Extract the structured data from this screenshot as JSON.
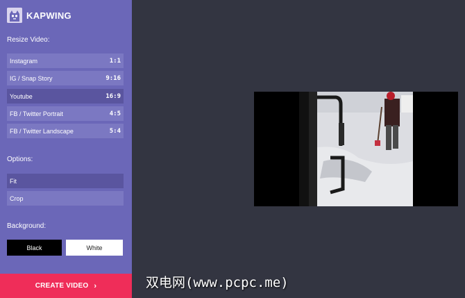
{
  "app": {
    "brand": "KAPWING"
  },
  "resize": {
    "heading": "Resize Video:",
    "options": [
      {
        "label": "Instagram",
        "ratio": "1:1"
      },
      {
        "label": "IG / Snap Story",
        "ratio": "9:16"
      },
      {
        "label": "Youtube",
        "ratio": "16:9",
        "selected": true
      },
      {
        "label": "FB / Twitter Portrait",
        "ratio": "4:5"
      },
      {
        "label": "FB / Twitter Landscape",
        "ratio": "5:4"
      }
    ]
  },
  "options": {
    "heading": "Options:",
    "items": [
      {
        "label": "Fit",
        "selected": true
      },
      {
        "label": "Crop"
      }
    ]
  },
  "background": {
    "heading": "Background:",
    "black_label": "Black",
    "white_label": "White"
  },
  "create_label": "CREATE VIDEO",
  "watermark": "双电网(www.pcpc.me)",
  "colors": {
    "sidebar": "#6b67b8",
    "option": "#7b78c2",
    "option_selected": "#5a559f",
    "create": "#ef2d59",
    "canvas": "#333541"
  }
}
